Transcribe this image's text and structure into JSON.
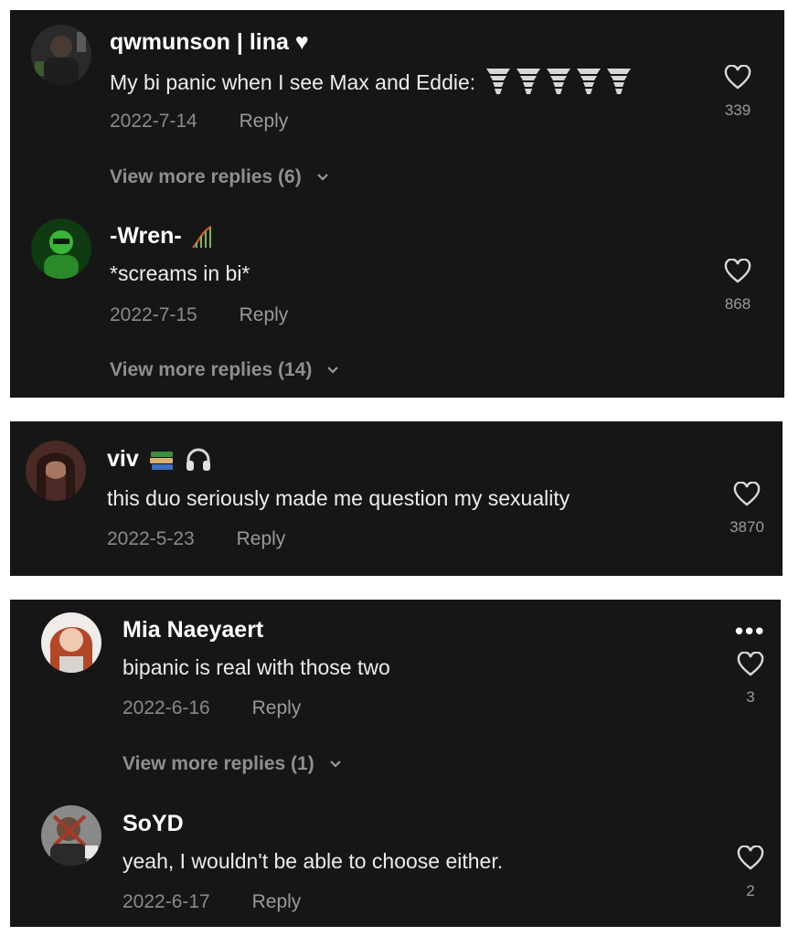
{
  "panel1": {
    "comments": [
      {
        "username": "qwmunson | lina",
        "username_suffix": "♥",
        "text": "My bi panic when I see Max and Eddie:",
        "date": "2022-7-14",
        "reply_label": "Reply",
        "likes": "339",
        "view_more": "View more replies (6)",
        "emoji": "tornado-emoji x5"
      },
      {
        "username": "-Wren-",
        "username_emoji": "roller-coaster-emoji",
        "text": "*screams in bi*",
        "date": "2022-7-15",
        "reply_label": "Reply",
        "likes": "868",
        "view_more": "View more replies (14)"
      }
    ]
  },
  "panel2": {
    "comments": [
      {
        "username": "viv",
        "username_emoji": "books-emoji, headphones-emoji",
        "text": "this duo seriously made me question my sexuality",
        "date": "2022-5-23",
        "reply_label": "Reply",
        "likes": "3870"
      }
    ]
  },
  "panel3": {
    "more_label": "•••",
    "comments": [
      {
        "username": "Mia Naeyaert",
        "text": "bipanic is real with those two",
        "date": "2022-6-16",
        "reply_label": "Reply",
        "likes": "3",
        "view_more": "View more replies (1)"
      },
      {
        "username": "SoYD",
        "text": "yeah, I wouldn't be able to choose either.",
        "date": "2022-6-17",
        "reply_label": "Reply",
        "likes": "2"
      }
    ]
  },
  "colors": {
    "panel_bg": "#161616",
    "text_primary": "#ffffff",
    "text_secondary": "#8a8a8a"
  }
}
